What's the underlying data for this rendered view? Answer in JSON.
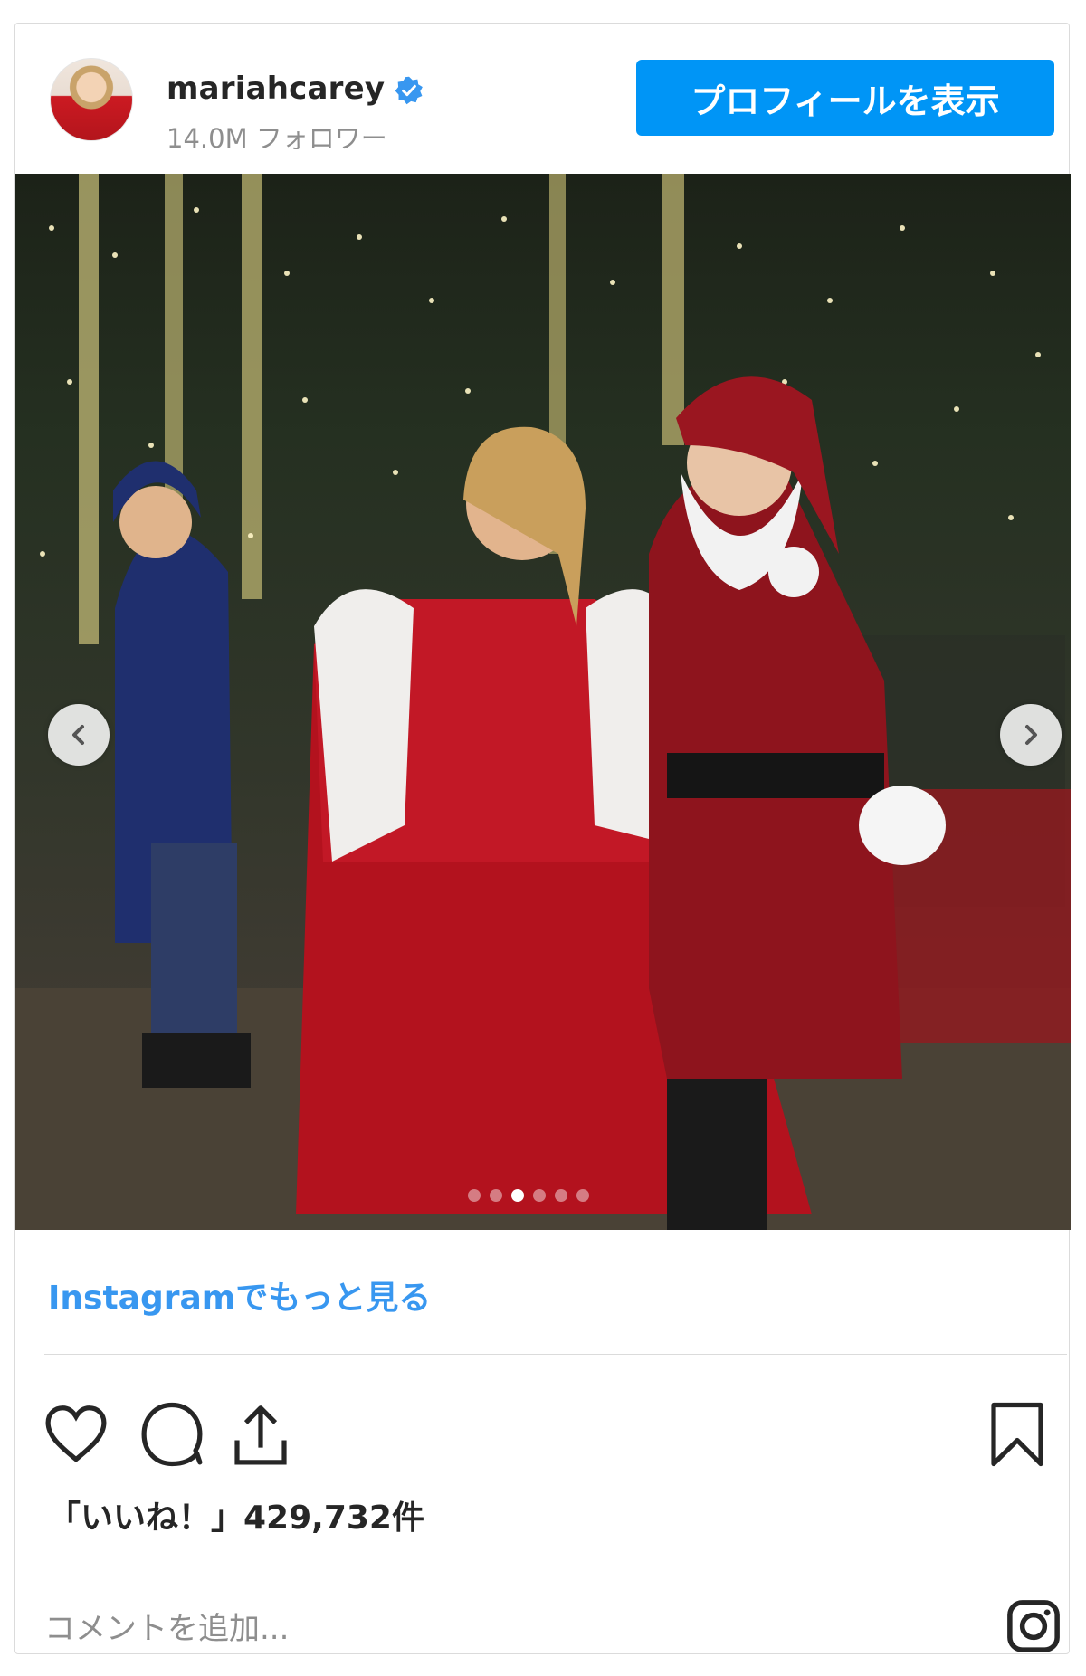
{
  "header": {
    "username": "mariahcarey",
    "followers": "14.0M フォロワー",
    "profile_button": "プロフィールを表示",
    "avatar_icon": "avatar-image",
    "verified_icon": "verified-badge-icon"
  },
  "post": {
    "carousel": {
      "total_slides": 6,
      "active_slide": 3
    },
    "more_link": "Instagramでもっと見る",
    "likes": "「いいね！」429,732件",
    "comment_placeholder": "コメントを追加..."
  },
  "colors": {
    "accent": "#0095f6",
    "link": "#3897f0",
    "text": "#262626",
    "muted": "#8e8e8e",
    "border": "#dbdbdb"
  },
  "icons": [
    "heart-icon",
    "comment-icon",
    "share-icon",
    "bookmark-icon",
    "instagram-icon",
    "chevron-left-icon",
    "chevron-right-icon"
  ]
}
